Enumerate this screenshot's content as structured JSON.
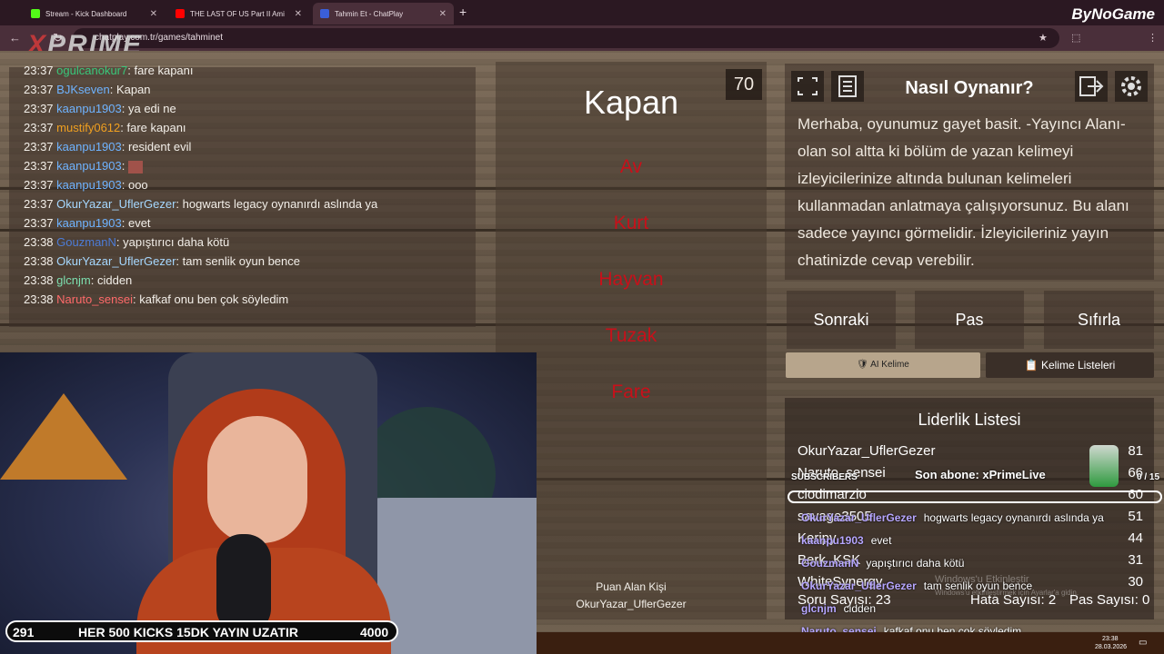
{
  "browser": {
    "tabs": [
      {
        "label": "Stream - Kick Dashboard",
        "color": "#53fc18"
      },
      {
        "label": "THE LAST OF US Part II Ami",
        "color": "#ff0000"
      },
      {
        "label": "Tahmin Et - ChatPlay",
        "color": "#3a5fd9"
      }
    ],
    "url": "chatplay.com.tr/games/tahminet",
    "overlay_brand": "ByNoGame",
    "stream_logo_a": "X",
    "stream_logo_b": "PRIME"
  },
  "chat": [
    {
      "time": "23:37",
      "user": "ogulcanokur7",
      "msg": ": fare kapanı",
      "color": "#39c77a"
    },
    {
      "time": "23:37",
      "user": "BJKseven",
      "msg": ": Kapan",
      "color": "#6fb3ff"
    },
    {
      "time": "23:37",
      "user": "kaanpu1903",
      "msg": ": ya edi ne",
      "color": "#6fb3ff"
    },
    {
      "time": "23:37",
      "user": "mustify0612",
      "msg": ": fare kapanı",
      "color": "#f0a020"
    },
    {
      "time": "23:37",
      "user": "kaanpu1903",
      "msg": ": resident evil",
      "color": "#6fb3ff"
    },
    {
      "time": "23:37",
      "user": "kaanpu1903",
      "msg": ":",
      "color": "#6fb3ff"
    },
    {
      "time": "23:37",
      "user": "kaanpu1903",
      "msg": ": ooo",
      "color": "#6fb3ff"
    },
    {
      "time": "23:37",
      "user": "OkurYazar_UflerGezer",
      "msg": ": hogwarts legacy oynanırdı aslında ya",
      "color": "#a6d8ff"
    },
    {
      "time": "23:37",
      "user": "kaanpu1903",
      "msg": ": evet",
      "color": "#6fb3ff"
    },
    {
      "time": "23:38",
      "user": "GouzmanN",
      "msg": ": yapıştırıcı daha kötü",
      "color": "#4d7cd6"
    },
    {
      "time": "23:38",
      "user": "OkurYazar_UflerGezer",
      "msg": ": tam senlik oyun bence",
      "color": "#a6d8ff"
    },
    {
      "time": "23:38",
      "user": "glcnjm",
      "msg": ": cidden",
      "color": "#7de0b0"
    },
    {
      "time": "23:38",
      "user": "Naruto_sensei",
      "msg": ": kafkaf onu ben çok söyledim",
      "color": "#ff6a6a"
    }
  ],
  "game": {
    "timer": "70",
    "word": "Kapan",
    "forbidden": [
      "Av",
      "Kurt",
      "Hayvan",
      "Tuzak",
      "Fare"
    ],
    "scorer_label": "Puan Alan Kişi",
    "scorer": "OkurYazar_UflerGezer"
  },
  "how": {
    "title": "Nasıl Oynanır?",
    "text": "Merhaba, oyunumuz gayet basit. -Yayıncı Alanı- olan sol altta ki bölüm de yazan kelimeyi izleyicilerinize altında bulunan kelimeleri kullanmadan anlatmaya çalışıyorsunuz. Bu alanı sadece yayıncı görmelidir. İzleyicileriniz yayın chatinizde cevap verebilir."
  },
  "buttons": {
    "next": "Sonraki",
    "pass": "Pas",
    "reset": "Sıfırla",
    "ai": "AI Kelime",
    "lists": "Kelime Listeleri"
  },
  "leaderboard": {
    "title": "Liderlik Listesi",
    "rows": [
      {
        "name": "OkurYazar_UflerGezer",
        "pts": "81"
      },
      {
        "name": "Naruto_sensei",
        "pts": "66"
      },
      {
        "name": "ciodimarzio",
        "pts": "60"
      },
      {
        "name": "savage3505",
        "pts": "51"
      },
      {
        "name": "Keripy",
        "pts": "44"
      },
      {
        "name": "Berk_KSK",
        "pts": "31"
      },
      {
        "name": "WhiteSynergy",
        "pts": "30"
      }
    ],
    "questions": "Soru Sayısı: 23",
    "errors": "Hata Sayısı: 2",
    "passes": "Pas Sayısı: 0"
  },
  "overlay": {
    "subs_label": "SUBSCRIBERS",
    "last_sub": "Son abone: xPrimeLive",
    "subs_count": "0 / 15",
    "kicks_left": "291",
    "kicks_text": "HER 500 KICKS 15DK YAYIN UZATIR",
    "kicks_goal": "4000",
    "chat": [
      {
        "user": "OkurYazar_UflerGezer",
        "msg": "hogwarts legacy oynanırdı aslında ya"
      },
      {
        "user": "kaanpu1903",
        "msg": "evet"
      },
      {
        "user": "GouzmanN",
        "msg": "yapıştırıcı daha kötü"
      },
      {
        "user": "OkurYazar_UflerGezer",
        "msg": "tam senlik oyun bence"
      },
      {
        "user": "glcnjm",
        "msg": "cidden"
      },
      {
        "user": "Naruto_sensei",
        "msg": "kafkaf onu ben çok söyledim"
      }
    ],
    "watermark1": "Windows'u Etkinleştir",
    "watermark2": "Windows'u etkinleştirmek için Ayarlar'a gidin."
  },
  "tray": {
    "time": "23:38",
    "date": "28.03.2026"
  }
}
